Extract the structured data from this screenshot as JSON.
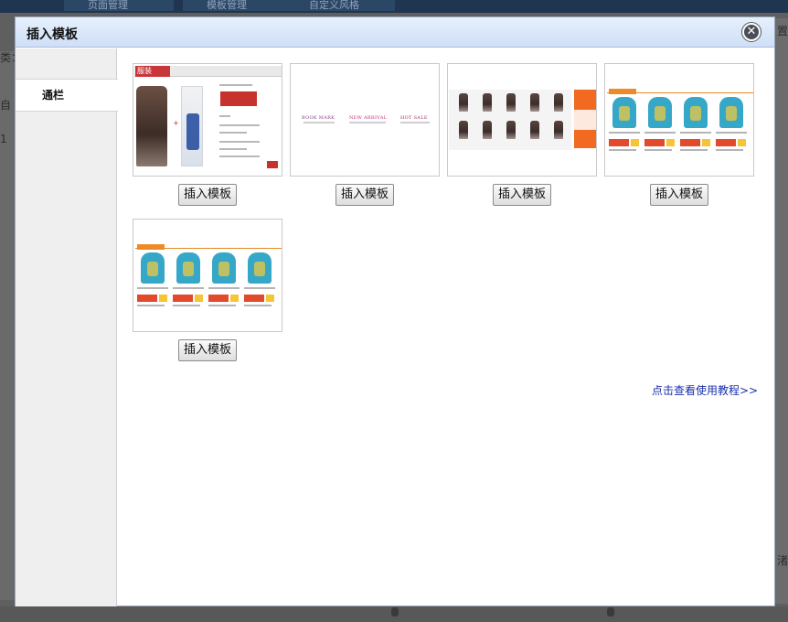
{
  "background": {
    "tabs": [
      "页面管理",
      "模板管理",
      "自定义风格"
    ],
    "left_labels": [
      "类：",
      "自",
      "1"
    ],
    "right_labels": [
      "置",
      "渚"
    ]
  },
  "modal": {
    "title": "插入模板",
    "close_icon": "close-icon",
    "sidebar": {
      "items": [
        {
          "label": "通栏",
          "active": true
        }
      ]
    },
    "templates": [
      {
        "thumbnail": "fashion-dress-template-thumbnail",
        "button_label": "插入模板"
      },
      {
        "thumbnail": "bookmark-arrival-sale-banner-thumbnail",
        "button_label": "插入模板"
      },
      {
        "thumbnail": "product-grid-orange-banner-thumbnail",
        "button_label": "插入模板"
      },
      {
        "thumbnail": "hoodie-price-list-thumbnail",
        "button_label": "插入模板"
      },
      {
        "thumbnail": "hoodie-price-list-thumbnail",
        "button_label": "插入模板"
      }
    ],
    "thumbnail_texts": {
      "fashion_logo": "服装",
      "bookmark": "BOOK MARK",
      "new_arrival": "NEW ARRIVAL",
      "hot_sale": "HOT SALE",
      "hoodie_price": "¥32.50",
      "hoodie_buy": "抢购"
    },
    "tutorial_link": "点击查看使用教程>>"
  },
  "colors": {
    "header_gradient_top": "#e6f0fd",
    "header_gradient_bottom": "#cfdff6",
    "link": "#1a30a8",
    "overlay": "#5f5f5f"
  }
}
